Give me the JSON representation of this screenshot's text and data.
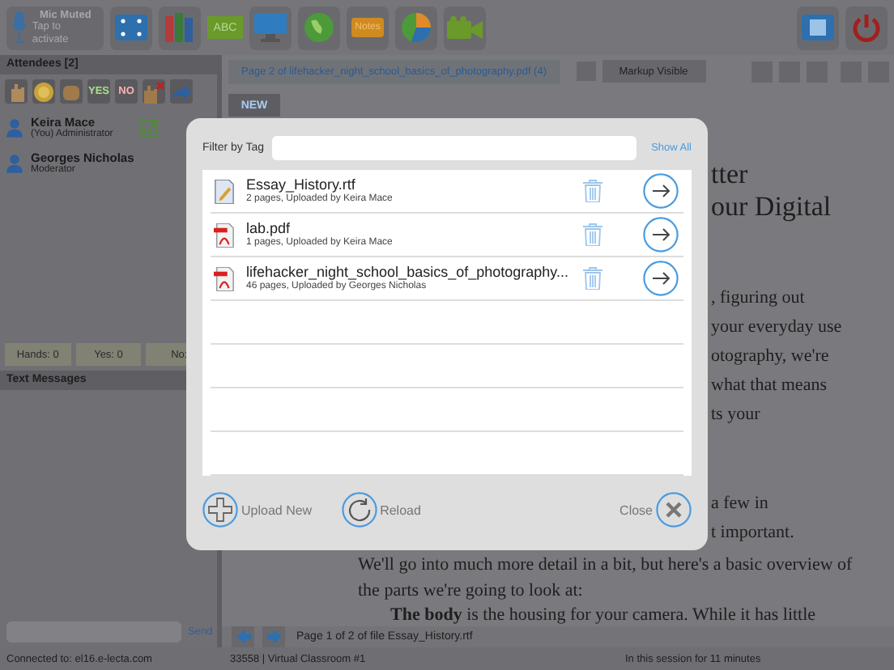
{
  "toolbar": {
    "mic": {
      "title": "Mic Muted",
      "subtitle": "Tap to activate"
    },
    "tools": [
      {
        "kind": "screen"
      },
      {
        "kind": "books"
      },
      {
        "kind": "abc",
        "label": "ABC"
      },
      {
        "kind": "monitor"
      },
      {
        "kind": "globe"
      },
      {
        "kind": "notes",
        "label": "Notes"
      },
      {
        "kind": "chart"
      },
      {
        "kind": "camera"
      }
    ]
  },
  "attendees": {
    "header": "Attendees [2]",
    "reactions": [
      {
        "kind": "hand"
      },
      {
        "kind": "coin"
      },
      {
        "kind": "fist"
      },
      {
        "kind": "text",
        "label": "YES",
        "color": "#a8e088"
      },
      {
        "kind": "text",
        "label": "NO",
        "color": "#ffb0b0"
      },
      {
        "kind": "hand-x"
      },
      {
        "kind": "arrow"
      }
    ],
    "people": [
      {
        "name": "Keira Mace",
        "role": "(You) Administrator",
        "confirmed": true
      },
      {
        "name": "Georges Nicholas",
        "role": "Moderator",
        "confirmed": false
      }
    ],
    "counts": [
      "Hands: 0",
      "Yes: 0",
      "No:"
    ]
  },
  "messages": {
    "header": "Text Messages",
    "send": "Send"
  },
  "document": {
    "tab": "Page 2 of lifehacker_night_school_basics_of_photography.pdf (4)",
    "markup": "Markup Visible",
    "new": "NEW",
    "lines": [
      {
        "kind": "heading",
        "text": "tter"
      },
      {
        "kind": "heading",
        "text": "our Digital"
      },
      {
        "kind": "gap"
      },
      {
        "kind": "fragment",
        "text": ", figuring out"
      },
      {
        "kind": "fragment",
        "text": "your everyday use"
      },
      {
        "kind": "fragment",
        "text": "otography, we're"
      },
      {
        "kind": "fragment",
        "text": "what that means"
      },
      {
        "kind": "fragment",
        "text": "ts your"
      },
      {
        "kind": "gap"
      },
      {
        "kind": "fragment",
        "text": "a few in"
      },
      {
        "kind": "fragment",
        "text": "t important."
      },
      {
        "kind": "full",
        "text": "We'll go into much more detail in a bit, but here's a basic overview of"
      },
      {
        "kind": "full",
        "text": "the parts we're going to look at:"
      },
      {
        "kind": "indent",
        "text": "**The body** is the housing for your camera. While it has little"
      }
    ],
    "nav": "Page 1 of 2 of file Essay_History.rtf"
  },
  "dialog": {
    "filter_label": "Filter by Tag",
    "show_all": "Show All",
    "files": [
      {
        "kind": "rtf",
        "name": "Essay_History.rtf",
        "meta": "2 pages, Uploaded by Keira Mace"
      },
      {
        "kind": "pdf",
        "name": "lab.pdf",
        "meta": "1 pages, Uploaded by Keira Mace"
      },
      {
        "kind": "pdf",
        "name": "lifehacker_night_school_basics_of_photography...",
        "meta": "46 pages, Uploaded by Georges Nicholas"
      }
    ],
    "upload": "Upload New",
    "reload": "Reload",
    "close": "Close"
  },
  "status_bar": {
    "connection": "Connected to: el16.e-lecta.com",
    "room": "33558 | Virtual Classroom #1",
    "duration": "In this session for 11 minutes"
  }
}
